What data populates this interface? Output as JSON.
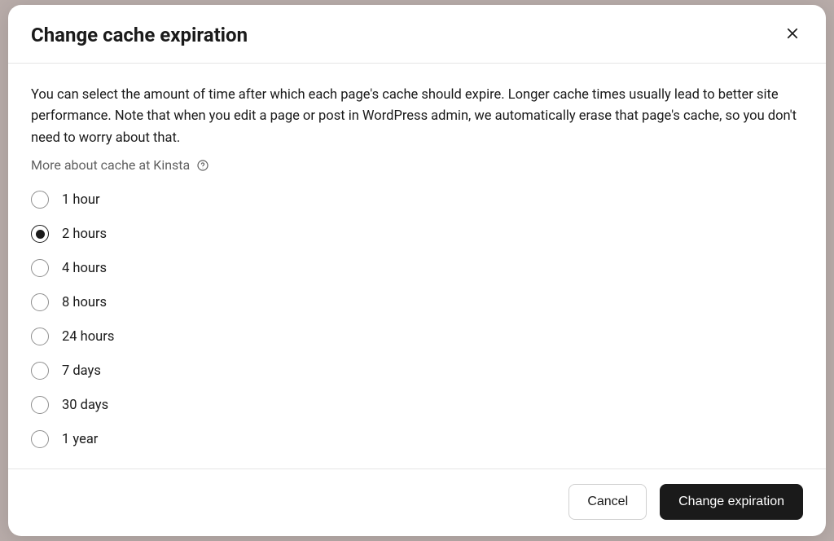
{
  "modal": {
    "title": "Change cache expiration",
    "description": "You can select the amount of time after which each page's cache should expire. Longer cache times usually lead to better site performance. Note that when you edit a page or post in WordPress admin, we automatically erase that page's cache, so you don't need to worry about that.",
    "more_link": "More about cache at Kinsta"
  },
  "options": [
    {
      "label": "1 hour",
      "selected": false
    },
    {
      "label": "2 hours",
      "selected": true
    },
    {
      "label": "4 hours",
      "selected": false
    },
    {
      "label": "8 hours",
      "selected": false
    },
    {
      "label": "24 hours",
      "selected": false
    },
    {
      "label": "7 days",
      "selected": false
    },
    {
      "label": "30 days",
      "selected": false
    },
    {
      "label": "1 year",
      "selected": false
    }
  ],
  "footer": {
    "cancel": "Cancel",
    "confirm": "Change expiration"
  }
}
